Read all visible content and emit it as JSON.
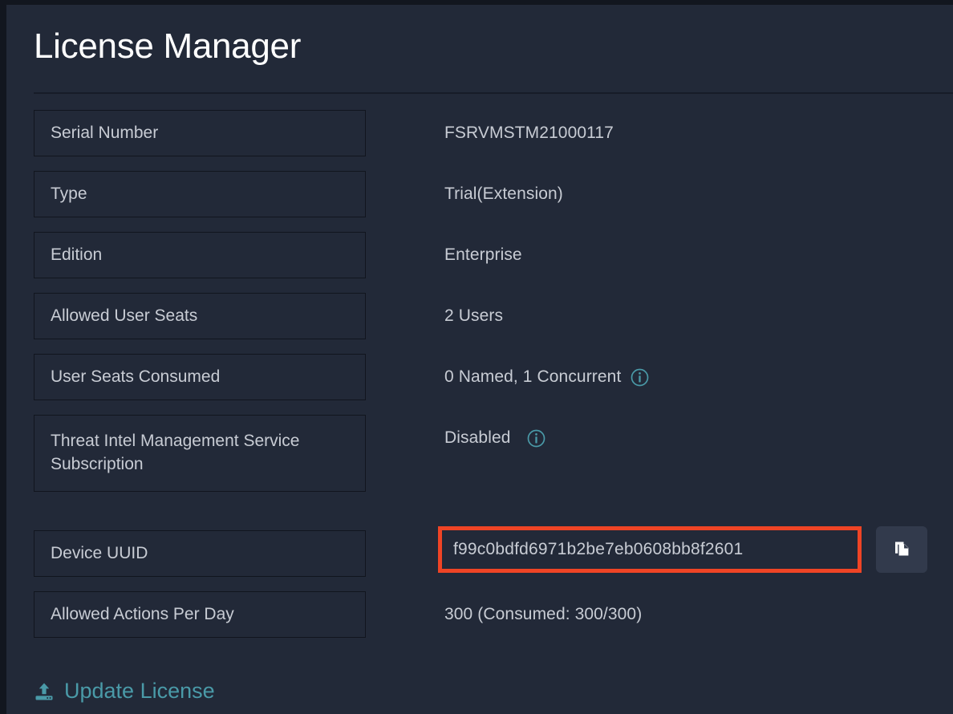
{
  "page": {
    "title": "License Manager"
  },
  "colors": {
    "background": "#12161f",
    "panel": "#222938",
    "label_box_border": "#11151e",
    "text_primary": "#ffffff",
    "text_secondary": "#c8ccd4",
    "accent_teal": "#4a9aa8",
    "highlight_red": "#ef4425",
    "copy_button_bg": "#323a4c"
  },
  "rows": [
    {
      "label": "Serial Number",
      "value": "FSRVMSTM21000117",
      "has_info_icon": false,
      "label_tall": false
    },
    {
      "label": "Type",
      "value": "Trial(Extension)",
      "has_info_icon": false,
      "label_tall": false
    },
    {
      "label": "Edition",
      "value": "Enterprise",
      "has_info_icon": false,
      "label_tall": false
    },
    {
      "label": "Allowed User Seats",
      "value": "2 Users",
      "has_info_icon": false,
      "label_tall": false
    },
    {
      "label": "User Seats Consumed",
      "value": "0 Named, 1 Concurrent",
      "has_info_icon": true,
      "label_tall": false
    },
    {
      "label": "Threat Intel Management Service Subscription",
      "value": "Disabled",
      "has_info_icon": true,
      "label_tall": true
    },
    {
      "label": "Device UUID",
      "value": "f99c0bdfd6971b2be7eb0608bb8f2601",
      "has_info_icon": false,
      "label_tall": false,
      "highlighted": true,
      "has_copy_button": true
    },
    {
      "label": "Allowed Actions Per Day",
      "value": "300 (Consumed: 300/300)",
      "has_info_icon": false,
      "label_tall": false
    }
  ],
  "footer": {
    "update_license_label": "Update License",
    "upload_icon": "upload-icon"
  },
  "icons": {
    "info": "info-icon",
    "copy": "copy-icon"
  }
}
